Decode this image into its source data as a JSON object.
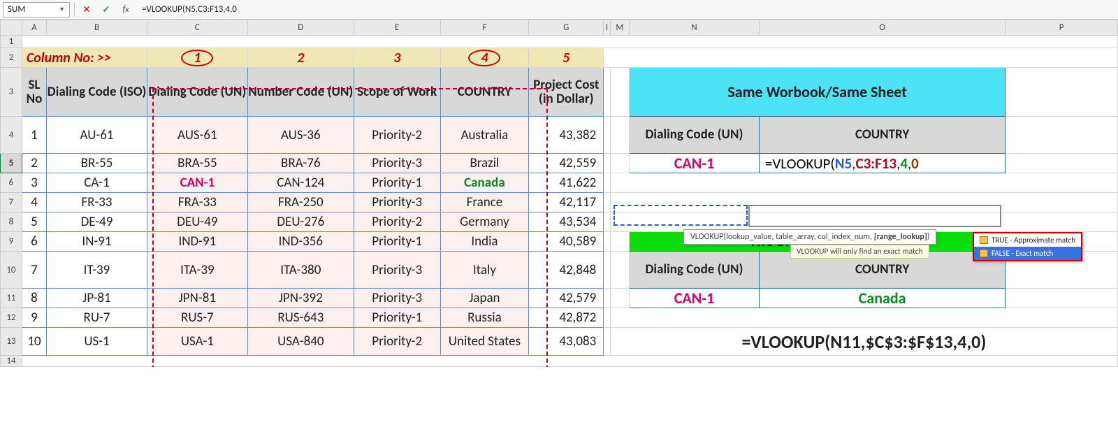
{
  "formulaBar": {
    "nameBox": "SUM",
    "formula": "=VLOOKUP(N5,C3:F13,4,0"
  },
  "cols": [
    "A",
    "B",
    "C",
    "D",
    "E",
    "F",
    "G",
    "I",
    "M",
    "N",
    "O",
    "P"
  ],
  "rows": [
    "1",
    "2",
    "3",
    "4",
    "5",
    "6",
    "7",
    "8",
    "9",
    "10",
    "11",
    "12",
    "13",
    "14"
  ],
  "colNoLabel": "Column No: >>",
  "colNos": [
    "1",
    "2",
    "3",
    "4",
    "5"
  ],
  "headers": {
    "A": "SL No",
    "B": "Dialing Code (ISO)",
    "C": "Dialing Code (UN)",
    "D": "Number Code (UN)",
    "E": "Scope of Work",
    "F": "COUNTRY",
    "G": "Project Cost (in Dollar)"
  },
  "data": [
    {
      "sl": "1",
      "iso": "AU-61",
      "un": "AUS-61",
      "num": "AUS-36",
      "sw": "Priority-2",
      "ctry": "Australia",
      "cost": "43,382"
    },
    {
      "sl": "2",
      "iso": "BR-55",
      "un": "BRA-55",
      "num": "BRA-76",
      "sw": "Priority-3",
      "ctry": "Brazil",
      "cost": "42,559"
    },
    {
      "sl": "3",
      "iso": "CA-1",
      "un": "CAN-1",
      "num": "CAN-124",
      "sw": "Priority-1",
      "ctry": "Canada",
      "cost": "41,622"
    },
    {
      "sl": "4",
      "iso": "FR-33",
      "un": "FRA-33",
      "num": "FRA-250",
      "sw": "Priority-3",
      "ctry": "France",
      "cost": "42,117"
    },
    {
      "sl": "5",
      "iso": "DE-49",
      "un": "DEU-49",
      "num": "DEU-276",
      "sw": "Priority-2",
      "ctry": "Germany",
      "cost": "43,534"
    },
    {
      "sl": "6",
      "iso": "IN-91",
      "un": "IND-91",
      "num": "IND-356",
      "sw": "Priority-1",
      "ctry": "India",
      "cost": "40,589"
    },
    {
      "sl": "7",
      "iso": "IT-39",
      "un": "ITA-39",
      "num": "ITA-380",
      "sw": "Priority-3",
      "ctry": "Italy",
      "cost": "42,848"
    },
    {
      "sl": "8",
      "iso": "JP-81",
      "un": "JPN-81",
      "num": "JPN-392",
      "sw": "Priority-3",
      "ctry": "Japan",
      "cost": "42,579"
    },
    {
      "sl": "9",
      "iso": "RU-7",
      "un": "RUS-7",
      "num": "RUS-643",
      "sw": "Priority-1",
      "ctry": "Russia",
      "cost": "42,872"
    },
    {
      "sl": "10",
      "iso": "US-1",
      "un": "USA-1",
      "num": "USA-840",
      "sw": "Priority-2",
      "ctry": "United States",
      "cost": "43,083"
    }
  ],
  "box1": {
    "title": "Same Worbook/Same Sheet",
    "h1": "Dialing Code (UN)",
    "h2": "COUNTRY",
    "key": "CAN-1",
    "formula": {
      "eqfn": "=VLOOKUP(",
      "a1": "N5",
      "c1": ",",
      "a2": "C3:F13",
      "c2": ",",
      "a3": "4",
      "c3": ",",
      "a4": "0"
    }
  },
  "tooltip": {
    "syntax_pre": "VLOOKUP(lookup_value, table_array, col_index_num, ",
    "syntax_b": "[range_lookup]",
    "syntax_post": ")",
    "hint": "VLOOKUP will only find an exact match",
    "opt_true": "TRUE - Approximate match",
    "opt_false": "FALSE - Exact match"
  },
  "box2": {
    "title": "Two Different Worbook",
    "h1": "Dialing Code (UN)",
    "h2": "COUNTRY",
    "key": "CAN-1",
    "val": "Canada"
  },
  "bigFormula": "=VLOOKUP(N11,$C$3:$F$13,4,0)"
}
